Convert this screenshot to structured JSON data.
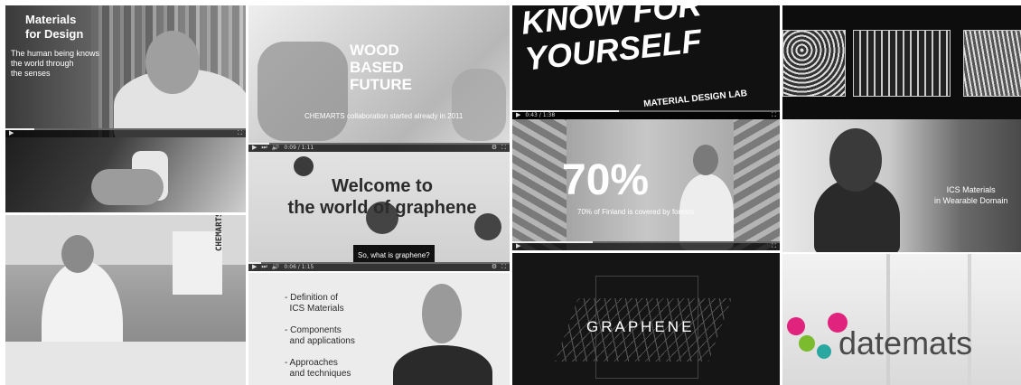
{
  "tiles": {
    "materials_for_design": {
      "title": "Materials\nfor Design",
      "subtitle": "The human being knows\nthe world through\nthe senses"
    },
    "wood_based_future": {
      "title": "WOOD\nBASED\nFUTURE",
      "caption": "CHEMARTS collaboration started already in 2011"
    },
    "graphene_intro": {
      "title": "Welcome to\nthe world of graphene",
      "subtitle": "So, what is graphene?"
    },
    "know_for_yourself": {
      "title": "KNOW FOR\nYOURSELF",
      "subtitle": "MATERIAL DESIGN LAB"
    },
    "seventy_percent": {
      "title": "70%",
      "caption": "70% of Finland is covered by forests"
    },
    "ics_wearable": {
      "title": "ICS Materials\nin Wearable Domain"
    },
    "chemarts_lab": {
      "sign": "CHEMARTS"
    },
    "ics_outline": {
      "items": [
        "- Definition of\n  ICS Materials",
        "- Components\n  and applications",
        "- Approaches\n  and techniques"
      ]
    },
    "graphene_logo": {
      "title": "GRAPHENE"
    },
    "datemats": {
      "logo": "datemats"
    }
  },
  "player": {
    "time_1": "0:09 / 1:11",
    "time_2": "0:06 / 1:15",
    "time_3": "0:43 / 1:38"
  },
  "colors": {
    "logo_magenta": "#e0237c",
    "logo_green": "#7bbb2e",
    "logo_teal": "#2aa7a0",
    "logo_text": "#4a4a4a"
  }
}
